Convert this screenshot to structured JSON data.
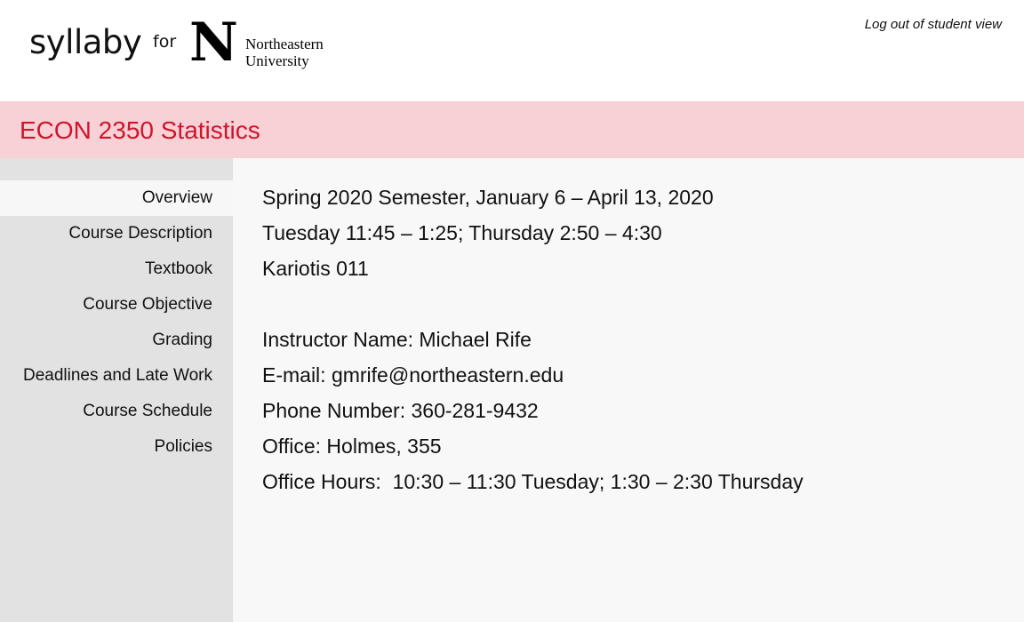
{
  "header": {
    "brand": "syllaby",
    "for_label": "for",
    "university_line1": "Northeastern",
    "university_line2": "University",
    "logout": "Log out of student view"
  },
  "course": {
    "title": "ECON 2350 Statistics"
  },
  "sidebar": {
    "items": [
      {
        "label": "Overview",
        "active": true
      },
      {
        "label": "Course Description"
      },
      {
        "label": "Textbook"
      },
      {
        "label": "Course Objective"
      },
      {
        "label": "Grading"
      },
      {
        "label": "Deadlines and Late Work"
      },
      {
        "label": "Course Schedule"
      },
      {
        "label": "Policies"
      }
    ]
  },
  "overview": {
    "semester": "Spring 2020 Semester, January 6 – April 13, 2020",
    "meeting_times": "Tuesday 11:45 – 1:25; Thursday 2:50 – 4:30",
    "room": "Kariotis 011",
    "instructor": "Instructor Name: Michael Rife",
    "email": "E-mail: gmrife@northeastern.edu",
    "phone": "Phone Number: 360-281-9432",
    "office": "Office: Holmes, 355",
    "office_hours": "Office Hours:  10:30 – 11:30 Tuesday; 1:30 – 2:30 Thursday"
  },
  "colors": {
    "accent": "#d0142c",
    "title_bar": "#f7d1d6",
    "sidebar_bg": "#e2e2e2",
    "main_bg": "#f8f8f8"
  }
}
